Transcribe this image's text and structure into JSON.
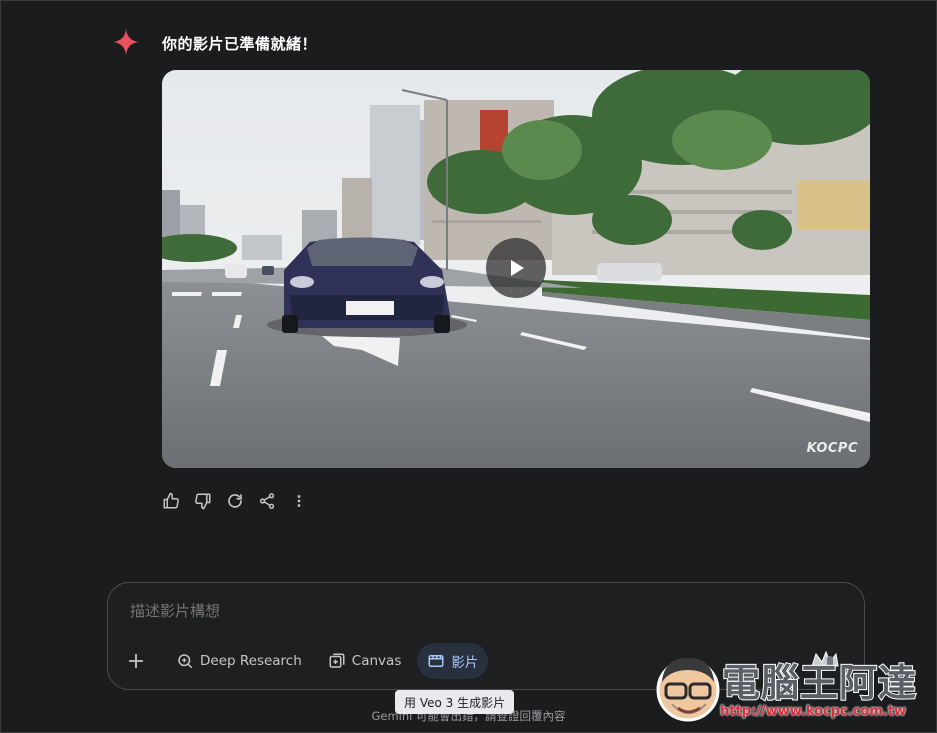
{
  "response": {
    "text": "你的影片已準備就緒！"
  },
  "video": {
    "watermark": "KOCPC"
  },
  "actions": [
    "thumb-up-icon",
    "thumb-down-icon",
    "refresh-icon",
    "share-icon",
    "more-vert-icon"
  ],
  "prompt": {
    "placeholder": "描述影片構想"
  },
  "toolbar": {
    "deep_research_label": "Deep Research",
    "canvas_label": "Canvas",
    "video_label": "影片"
  },
  "tooltip": "用 Veo 3 生成影片",
  "disclaimer": "Gemini 可能會出錯，請查證回覆內容",
  "logo": {
    "title": "電腦王阿達",
    "url": "http://www.kocpc.com.tw"
  },
  "colors": {
    "background": "#1b1c1e",
    "accent": "#a8c7fa",
    "sparkle": "#e8515d"
  }
}
